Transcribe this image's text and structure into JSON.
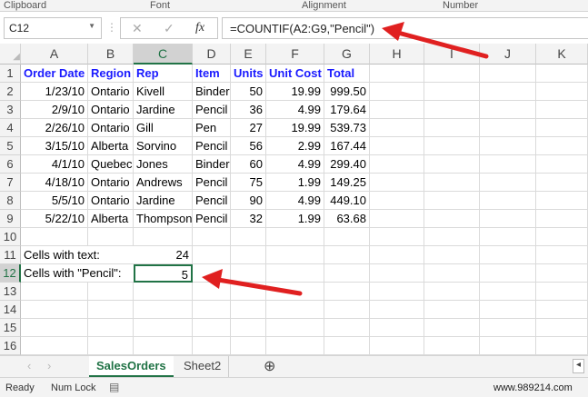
{
  "ribbon": {
    "groups": [
      "Clipboard",
      "Font",
      "Alignment",
      "Number"
    ]
  },
  "formula_bar": {
    "name_box": "C12",
    "cancel": "✕",
    "enter": "✓",
    "fx": "fx",
    "formula": "=COUNTIF(A2:G9,\"Pencil\")"
  },
  "columns": [
    "A",
    "B",
    "C",
    "D",
    "E",
    "F",
    "G",
    "H",
    "I",
    "J",
    "K"
  ],
  "selected_column": "C",
  "selected_row": 12,
  "rows": [
    [
      "Order Date",
      "Region",
      "Rep",
      "Item",
      "Units",
      "Unit Cost",
      "Total"
    ],
    [
      "1/23/10",
      "Ontario",
      "Kivell",
      "Binder",
      "50",
      "19.99",
      "999.50"
    ],
    [
      "2/9/10",
      "Ontario",
      "Jardine",
      "Pencil",
      "36",
      "4.99",
      "179.64"
    ],
    [
      "2/26/10",
      "Ontario",
      "Gill",
      "Pen",
      "27",
      "19.99",
      "539.73"
    ],
    [
      "3/15/10",
      "Alberta",
      "Sorvino",
      "Pencil",
      "56",
      "2.99",
      "167.44"
    ],
    [
      "4/1/10",
      "Quebec",
      "Jones",
      "Binder",
      "60",
      "4.99",
      "299.40"
    ],
    [
      "4/18/10",
      "Ontario",
      "Andrews",
      "Pencil",
      "75",
      "1.99",
      "149.25"
    ],
    [
      "5/5/10",
      "Ontario",
      "Jardine",
      "Pencil",
      "90",
      "4.99",
      "449.10"
    ],
    [
      "5/22/10",
      "Alberta",
      "Thompson",
      "Pencil",
      "32",
      "1.99",
      "63.68"
    ]
  ],
  "summary": [
    {
      "row": 11,
      "label": "Cells with text:",
      "value": "24"
    },
    {
      "row": 12,
      "label": "Cells with \"Pencil\":",
      "value": "5"
    }
  ],
  "row_numbers": [
    "1",
    "2",
    "3",
    "4",
    "5",
    "6",
    "7",
    "8",
    "9",
    "10",
    "11",
    "12",
    "13",
    "14",
    "15",
    "16"
  ],
  "sheet_tabs": {
    "tabs": [
      "SalesOrders",
      "Sheet2"
    ],
    "active": "SalesOrders",
    "add": "⊕"
  },
  "status": {
    "ready": "Ready",
    "num_lock": "Num Lock",
    "watermark": "www.989214.com"
  },
  "colors": {
    "accent": "#217346",
    "header_text": "#1a1aff",
    "arrow": "#e02020"
  }
}
